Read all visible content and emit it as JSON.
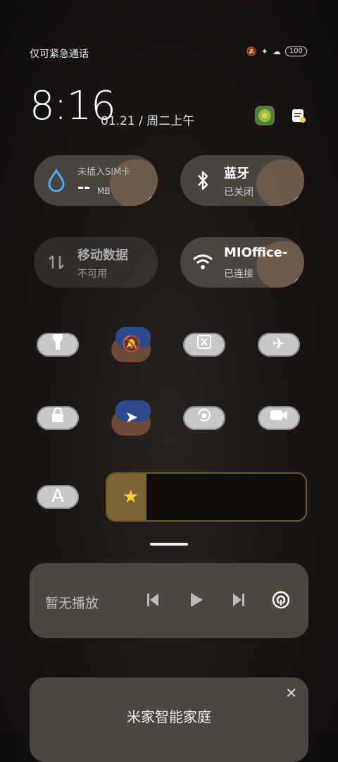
{
  "status": {
    "carrier": "仅可紧急通话",
    "battery": "100"
  },
  "clock": {
    "time": "8:16",
    "date": "01.21 / 周二上午"
  },
  "tiles": {
    "data_usage": {
      "title": "未插入SIM卡",
      "value": "--",
      "unit": "MB"
    },
    "bluetooth": {
      "title": "蓝牙",
      "sub": "已关闭"
    },
    "mobile_data": {
      "title": "移动数据",
      "sub": "不可用"
    },
    "wifi": {
      "title": "MIOffice-",
      "sub": "已连接"
    }
  },
  "toggles": [
    {
      "name": "flashlight",
      "icon": "flashlight-icon"
    },
    {
      "name": "silent",
      "icon": "bell-off-icon"
    },
    {
      "name": "screenshot",
      "icon": "screenshot-icon"
    },
    {
      "name": "airplane",
      "icon": "airplane-icon"
    },
    {
      "name": "lock",
      "icon": "lock-icon"
    },
    {
      "name": "location",
      "icon": "location-icon"
    },
    {
      "name": "rotation-lock",
      "icon": "rotation-lock-icon"
    },
    {
      "name": "screen-record",
      "icon": "camera-icon"
    },
    {
      "name": "auto-brightness",
      "icon": "letter-a-icon"
    }
  ],
  "brightness": {
    "level": 0.2
  },
  "media": {
    "label": "暂无播放"
  },
  "smart_home": {
    "title": "米家智能家庭"
  },
  "colors": {
    "wifi_tile": "#5a544e",
    "drop_icon": "#4aa8ff",
    "star": "#f5cc3a",
    "slider_fill": "#7a6636"
  }
}
